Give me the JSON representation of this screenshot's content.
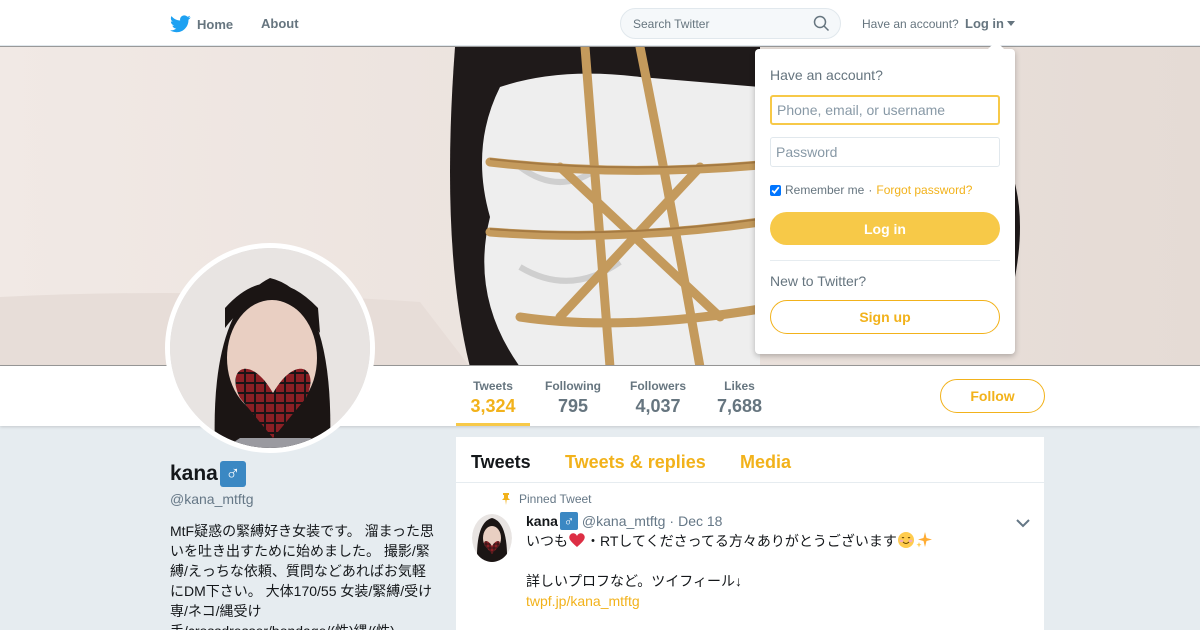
{
  "nav": {
    "home_label": "Home",
    "about_label": "About",
    "search_placeholder": "Search Twitter",
    "have_account": "Have an account?",
    "login_label": "Log in",
    "icons": {
      "logo": "twitter-bird-icon",
      "search": "magnifier-icon",
      "caret": "caret-down-icon"
    }
  },
  "colors": {
    "accent": "#f7c948",
    "accent_text": "#f2b21b",
    "brand": "#1da1f2"
  },
  "stats": [
    {
      "label": "Tweets",
      "value": "3,324",
      "active": true
    },
    {
      "label": "Following",
      "value": "795"
    },
    {
      "label": "Followers",
      "value": "4,037"
    },
    {
      "label": "Likes",
      "value": "7,688"
    }
  ],
  "follow_label": "Follow",
  "profile": {
    "name": "kana",
    "badge": "♂",
    "handle": "@kana_mtftg",
    "bio": "MtF疑惑の緊縛好き女装です。 溜まった思いを吐き出すために始めました。 撮影/緊縛/えっちな依頼、質問などあればお気軽にDM下さい。 大体170/55 女装/緊縛/受け専/ネコ/縄受け手/crossdresser/bondage/(性)縄/(性)娘/(性)…"
  },
  "timeline": {
    "tabs": [
      "Tweets",
      "Tweets & replies",
      "Media"
    ],
    "pinned_label": "Pinned Tweet",
    "tweet": {
      "name": "kana",
      "badge": "♂",
      "handle": "@kana_mtftg",
      "sep": "·",
      "date": "Dec 18",
      "line1_a": "いつも",
      "line1_b": "・RTしてくださってる方々ありがとうございます",
      "line2": "詳しいプロフなど。ツイフィール↓",
      "link": "twpf.jp/kana_mtftg"
    }
  },
  "login_dropdown": {
    "title": "Have an account?",
    "username_placeholder": "Phone, email, or username",
    "password_placeholder": "Password",
    "remember_label": "Remember me",
    "separator": "·",
    "forgot_label": "Forgot password?",
    "login_button": "Log in",
    "new_to": "New to Twitter?",
    "signup_button": "Sign up"
  }
}
